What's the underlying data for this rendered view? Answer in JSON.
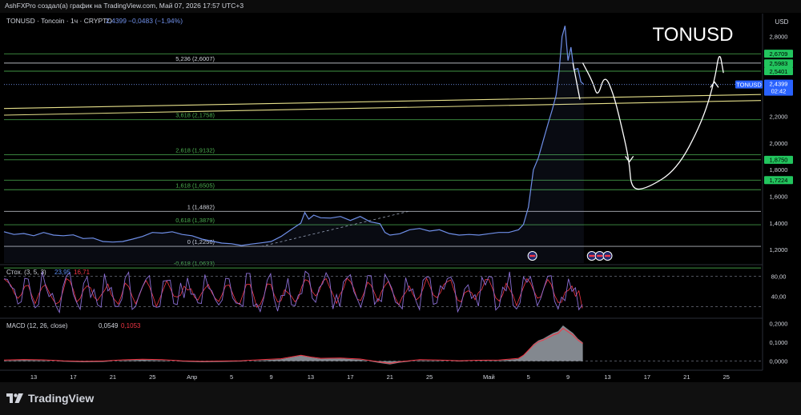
{
  "header": {
    "publish_line": "AshFXPro создал(а) график на TradingView.com, Май 07, 2026 17:57 UTC+3"
  },
  "chart_data": {
    "type": "line",
    "symbol_line": {
      "name": "TONUSD · Toncoin · 1ч · CRYPTO",
      "price": "2,4399",
      "change": "−0,0483 (−1,94%)"
    },
    "watermark": "TONUSD",
    "currency": "USD",
    "price_axis": [
      "2,8000",
      "2,6000",
      "2,4000",
      "2,2000",
      "2,0000",
      "1,8000",
      "1,6000",
      "1,4000",
      "1,2000"
    ],
    "time_axis": [
      "13",
      "17",
      "21",
      "25",
      "Апр",
      "5",
      "9",
      "13",
      "17",
      "21",
      "25",
      "Май",
      "5",
      "9",
      "13",
      "17",
      "21",
      "25"
    ],
    "time_axis_days": [
      13,
      17,
      21,
      25,
      29,
      33,
      37,
      41,
      45,
      49,
      53,
      59,
      63,
      67,
      71,
      75,
      79,
      83
    ],
    "ylim": [
      1.1,
      2.96
    ],
    "xlim": [
      10,
      86.5
    ],
    "last_price_tag": {
      "label": "TONUSD",
      "price": "2,4399",
      "countdown": "02:42",
      "value": 2.4399
    },
    "series": [
      {
        "color": "#6f8fe8",
        "points": [
          [
            10,
            1.335
          ],
          [
            11,
            1.315
          ],
          [
            12,
            1.322
          ],
          [
            13,
            1.305
          ],
          [
            14,
            1.33
          ],
          [
            15,
            1.31
          ],
          [
            16,
            1.305
          ],
          [
            17,
            1.312
          ],
          [
            18,
            1.284
          ],
          [
            19,
            1.288
          ],
          [
            20,
            1.262
          ],
          [
            21,
            1.258
          ],
          [
            22,
            1.262
          ],
          [
            23,
            1.28
          ],
          [
            24,
            1.3
          ],
          [
            25,
            1.33
          ],
          [
            26,
            1.325
          ],
          [
            27,
            1.335
          ],
          [
            28,
            1.315
          ],
          [
            29,
            1.305
          ],
          [
            30,
            1.28
          ],
          [
            31,
            1.265
          ],
          [
            32,
            1.25
          ],
          [
            33,
            1.245
          ],
          [
            34,
            1.232
          ],
          [
            35,
            1.243
          ],
          [
            36,
            1.252
          ],
          [
            37,
            1.262
          ],
          [
            38,
            1.3
          ],
          [
            39,
            1.35
          ],
          [
            40,
            1.4
          ],
          [
            40.4,
            1.48
          ],
          [
            40.8,
            1.43
          ],
          [
            41.3,
            1.46
          ],
          [
            42,
            1.44
          ],
          [
            43,
            1.438
          ],
          [
            44,
            1.45
          ],
          [
            45,
            1.42
          ],
          [
            46,
            1.45
          ],
          [
            47,
            1.41
          ],
          [
            48,
            1.395
          ],
          [
            48.5,
            1.33
          ],
          [
            49,
            1.31
          ],
          [
            50,
            1.32
          ],
          [
            51,
            1.35
          ],
          [
            52,
            1.36
          ],
          [
            53,
            1.34
          ],
          [
            54,
            1.35
          ],
          [
            55,
            1.322
          ],
          [
            56,
            1.31
          ],
          [
            57,
            1.315
          ],
          [
            58,
            1.31
          ],
          [
            59,
            1.32
          ],
          [
            60,
            1.33
          ],
          [
            61,
            1.33
          ],
          [
            62,
            1.35
          ],
          [
            62.5,
            1.39
          ],
          [
            63,
            1.52
          ],
          [
            63.5,
            1.8
          ],
          [
            64,
            1.89
          ],
          [
            64.5,
            2.02
          ],
          [
            65,
            2.15
          ],
          [
            65.4,
            2.25
          ],
          [
            65.8,
            2.36
          ],
          [
            66.1,
            2.54
          ],
          [
            66.4,
            2.8
          ],
          [
            66.7,
            2.88
          ],
          [
            67.0,
            2.62
          ],
          [
            67.3,
            2.72
          ],
          [
            67.6,
            2.55
          ],
          [
            68.0,
            2.56
          ],
          [
            68.3,
            2.46
          ],
          [
            68.6,
            2.44
          ]
        ]
      }
    ],
    "fib_levels": [
      {
        "label": "5,236 (2,6007)",
        "value": 2.6007,
        "color": "#d1d4dc"
      },
      {
        "label": "3,618 (2,1758)",
        "value": 2.1758,
        "color": "#4caf50"
      },
      {
        "label": "2,618 (1,9132)",
        "value": 1.9132,
        "color": "#4caf50"
      },
      {
        "label": "1,618 (1,6505)",
        "value": 1.6505,
        "color": "#4caf50"
      },
      {
        "label": "1 (1,4882)",
        "value": 1.4882,
        "color": "#d1d4dc"
      },
      {
        "label": "0,618 (1,3879)",
        "value": 1.3879,
        "color": "#4caf50"
      },
      {
        "label": "0 (1,2256)",
        "value": 1.2256,
        "color": "#d1d4dc"
      },
      {
        "label": "-0,618 (1,0633)",
        "value": 1.0633,
        "color": "#4caf50"
      }
    ],
    "extra_lines": [
      2.67,
      2.54,
      1.875,
      1.7224
    ],
    "price_tags": [
      {
        "text": "2,6709",
        "value": 2.6709,
        "color": "#22c55e"
      },
      {
        "text": "2,5983",
        "value": 2.5983,
        "color": "#22c55e"
      },
      {
        "text": "2,5401",
        "value": 2.5401,
        "color": "#22c55e"
      },
      {
        "text": "1,8750",
        "value": 1.875,
        "color": "#22c55e"
      },
      {
        "text": "1,7224",
        "value": 1.7224,
        "color": "#22c55e"
      }
    ],
    "trend_lines": [
      {
        "from": [
          10,
          2.26
        ],
        "to": [
          86.5,
          2.365
        ],
        "color": "#e6e08a"
      },
      {
        "from": [
          10,
          2.21
        ],
        "to": [
          86.5,
          2.32
        ],
        "color": "#e6e08a"
      }
    ],
    "dashed_line": {
      "from": [
        36,
        1.225
      ],
      "to": [
        51,
        1.49
      ],
      "color": "#9aa3b5"
    },
    "forecast_curves": [
      [
        [
          68.5,
          2.6
        ],
        [
          69.5,
          2.46
        ],
        [
          70,
          2.34
        ],
        [
          70.7,
          2.52
        ],
        [
          71.6,
          2.37
        ],
        [
          72.5,
          2.1
        ],
        [
          73.2,
          1.86
        ],
        [
          73.4,
          1.65
        ],
        [
          75,
          1.66
        ],
        [
          78,
          1.8
        ],
        [
          80.5,
          2.15
        ],
        [
          81.8,
          2.46
        ],
        [
          82.3,
          2.7
        ],
        [
          82.7,
          2.53
        ]
      ],
      [
        [
          67.5,
          2.6
        ],
        [
          68.2,
          2.33
        ]
      ]
    ],
    "forecast_arrows": [
      {
        "tip": [
          73.2,
          1.86
        ],
        "dir": "down"
      },
      {
        "tip": [
          81.8,
          2.46
        ],
        "dir": "up"
      }
    ],
    "event_markers": [
      63.4,
      69.4,
      70.2,
      71.0
    ],
    "stochastic": {
      "label": "Стох. (3, 5, 3)",
      "k": "23,95",
      "d": "16,71",
      "k_color": "#5b8cf0",
      "d_color": "#f23645",
      "levels": [
        "80,00",
        "40,00"
      ],
      "ylim": [
        0,
        100
      ],
      "bands": [
        80,
        20
      ]
    },
    "macd": {
      "label": "MACD (12, 26, close)",
      "value": "0,0549",
      "signal": "0,1053",
      "signal_color": "#f23645",
      "levels": [
        "0,2000",
        "0,1000",
        "0,0000"
      ],
      "ylim": [
        -0.04,
        0.22
      ],
      "histogram": [
        [
          10,
          0.002
        ],
        [
          12,
          0.005
        ],
        [
          14,
          0.003
        ],
        [
          16,
          -0.003
        ],
        [
          18,
          -0.006
        ],
        [
          20,
          -0.004
        ],
        [
          22,
          0.003
        ],
        [
          24,
          0.007
        ],
        [
          26,
          0.004
        ],
        [
          28,
          -0.003
        ],
        [
          30,
          -0.006
        ],
        [
          32,
          -0.004
        ],
        [
          34,
          -0.002
        ],
        [
          36,
          0.004
        ],
        [
          38,
          0.01
        ],
        [
          40,
          0.03
        ],
        [
          41,
          0.02
        ],
        [
          42,
          0.012
        ],
        [
          44,
          0.014
        ],
        [
          46,
          0.008
        ],
        [
          48,
          -0.01
        ],
        [
          49,
          -0.018
        ],
        [
          50,
          -0.008
        ],
        [
          52,
          0.004
        ],
        [
          54,
          0.002
        ],
        [
          56,
          -0.002
        ],
        [
          58,
          0.001
        ],
        [
          60,
          0.002
        ],
        [
          62,
          0.012
        ],
        [
          62.5,
          0.03
        ],
        [
          63,
          0.06
        ],
        [
          63.5,
          0.09
        ],
        [
          64,
          0.11
        ],
        [
          64.5,
          0.12
        ],
        [
          65,
          0.135
        ],
        [
          65.5,
          0.15
        ],
        [
          66,
          0.16
        ],
        [
          66.5,
          0.19
        ],
        [
          67,
          0.17
        ],
        [
          67.5,
          0.15
        ],
        [
          68,
          0.12
        ],
        [
          68.5,
          0.1
        ]
      ]
    }
  },
  "footer": {
    "brand": "TradingView"
  }
}
